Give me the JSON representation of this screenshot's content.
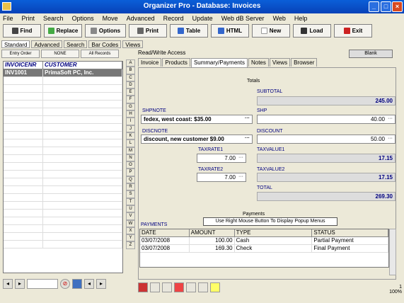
{
  "window": {
    "title": "Organizer Pro  -  Database: Invoices"
  },
  "menu": [
    "File",
    "Print",
    "Search",
    "Options",
    "Move",
    "Advanced",
    "Record",
    "Update",
    "Web dB Server",
    "Web",
    "Help"
  ],
  "toolbar": [
    "Find",
    "Replace",
    "Options",
    "Print",
    "Table",
    "HTML",
    "New",
    "Load",
    "Exit"
  ],
  "left_tabs": [
    "Standard",
    "Advanced",
    "Search",
    "Bar Codes",
    "Views"
  ],
  "left_buttons": [
    "Entry Order",
    "NONE",
    "All Records"
  ],
  "left_grid": {
    "headers": [
      "INVOICENR",
      "CUSTOMER"
    ],
    "rows": [
      [
        "INV1001",
        "PrimaSoft PC, Inc."
      ]
    ]
  },
  "alpha": [
    "A",
    "B",
    "C",
    "D",
    "E",
    "F",
    "G",
    "H",
    "I",
    "J",
    "K",
    "L",
    "M",
    "N",
    "O",
    "P",
    "Q",
    "R",
    "S",
    "T",
    "U",
    "V",
    "W",
    "X",
    "Y",
    "Z"
  ],
  "rw_label": "Read/Write Access",
  "blank_label": "Blank",
  "right_tabs": [
    "Invoice",
    "Products",
    "Summary/Payments",
    "Notes",
    "Views",
    "Browser"
  ],
  "section": {
    "totals": "Totals",
    "payments": "Payments"
  },
  "fields": {
    "subtotal_label": "SUBTOTAL",
    "subtotal": "245.00",
    "shpnote_label": "SHPNOTE",
    "shpnote": "fedex, west coast: $35.00",
    "shp_label": "SHP",
    "shp": "40.00",
    "discnote_label": "DISCNOTE",
    "discnote": "discount, new customer $9.00",
    "discount_label": "DISCOUNT",
    "discount": "50.00",
    "taxrate1_label": "TAXRATE1",
    "taxrate1": "7.00",
    "taxvalue1_label": "TAXVALUE1",
    "taxvalue1": "17.15",
    "taxrate2_label": "TAXRATE2",
    "taxrate2": "7.00",
    "taxvalue2_label": "TAXVALUE2",
    "taxvalue2": "17.15",
    "total_label": "TOTAL",
    "total": "269.30"
  },
  "tooltip": "Use Right Mouse Button To Display Popup Menus",
  "payments_label": "PAYMENTS",
  "payments": {
    "headers": [
      "DATE",
      "AMOUNT",
      "TYPE",
      "STATUS"
    ],
    "rows": [
      [
        "03/07/2008",
        "100.00",
        "Cash",
        "Partial Payment"
      ],
      [
        "03/07/2008",
        "169.30",
        "Check",
        "Final Payment"
      ]
    ]
  },
  "status": {
    "record": "1",
    "zoom": "100%"
  }
}
